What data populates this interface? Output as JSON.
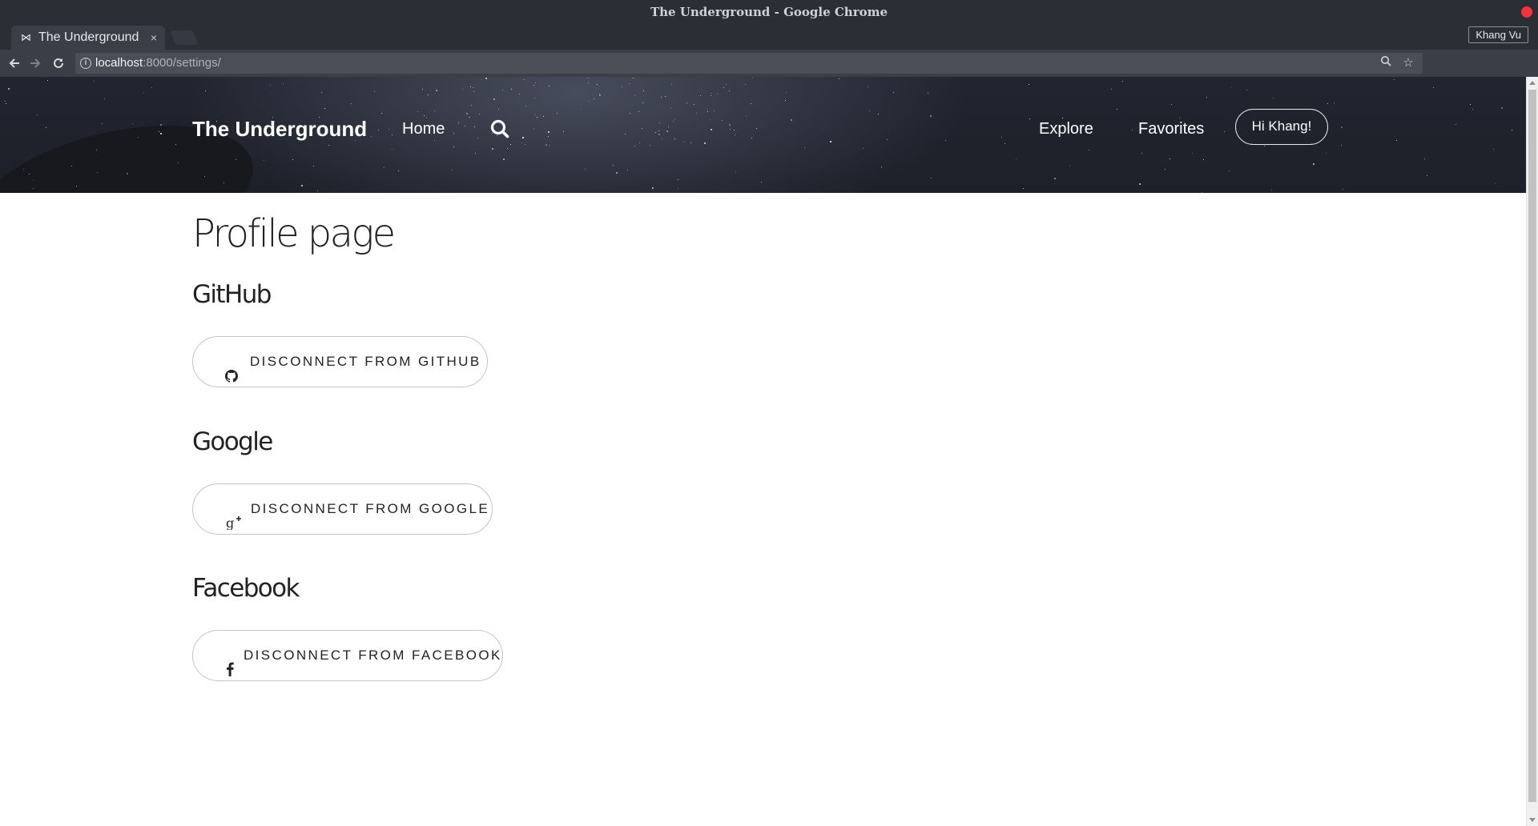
{
  "window": {
    "title": "The Underground - Google Chrome"
  },
  "tabs": [
    {
      "label": "The Underground",
      "close": "×"
    }
  ],
  "profile": {
    "name": "Khang Vu"
  },
  "toolbar": {
    "url_host": "localhost",
    "url_path": ":8000/settings/"
  },
  "icons": {
    "back": "arrow-left-icon",
    "forward": "arrow-right-icon",
    "reload": "reload-icon",
    "info": "info-icon",
    "zoom": "zoom-icon",
    "bookmark": "star-icon",
    "menu": "kebab-menu-icon"
  },
  "nav": {
    "brand": "The Underground",
    "home": "Home",
    "explore": "Explore",
    "favorites": "Favorites",
    "greeting": "Hi Khang!"
  },
  "main": {
    "title": "Profile page",
    "sections": [
      {
        "heading": "GitHub",
        "button": "DISCONNECT FROM GITHUB",
        "icon": "github-icon"
      },
      {
        "heading": "Google",
        "button": "DISCONNECT FROM GOOGLE",
        "icon": "google-plus-icon"
      },
      {
        "heading": "Facebook",
        "button": "DISCONNECT FROM FACEBOOK",
        "icon": "facebook-icon"
      }
    ]
  },
  "colors": {
    "browser_chrome": "#2b2e35",
    "toolbar": "#3a3e47",
    "hero": "#1f222b",
    "text": "#222222",
    "button_border": "#c6c6c6"
  }
}
